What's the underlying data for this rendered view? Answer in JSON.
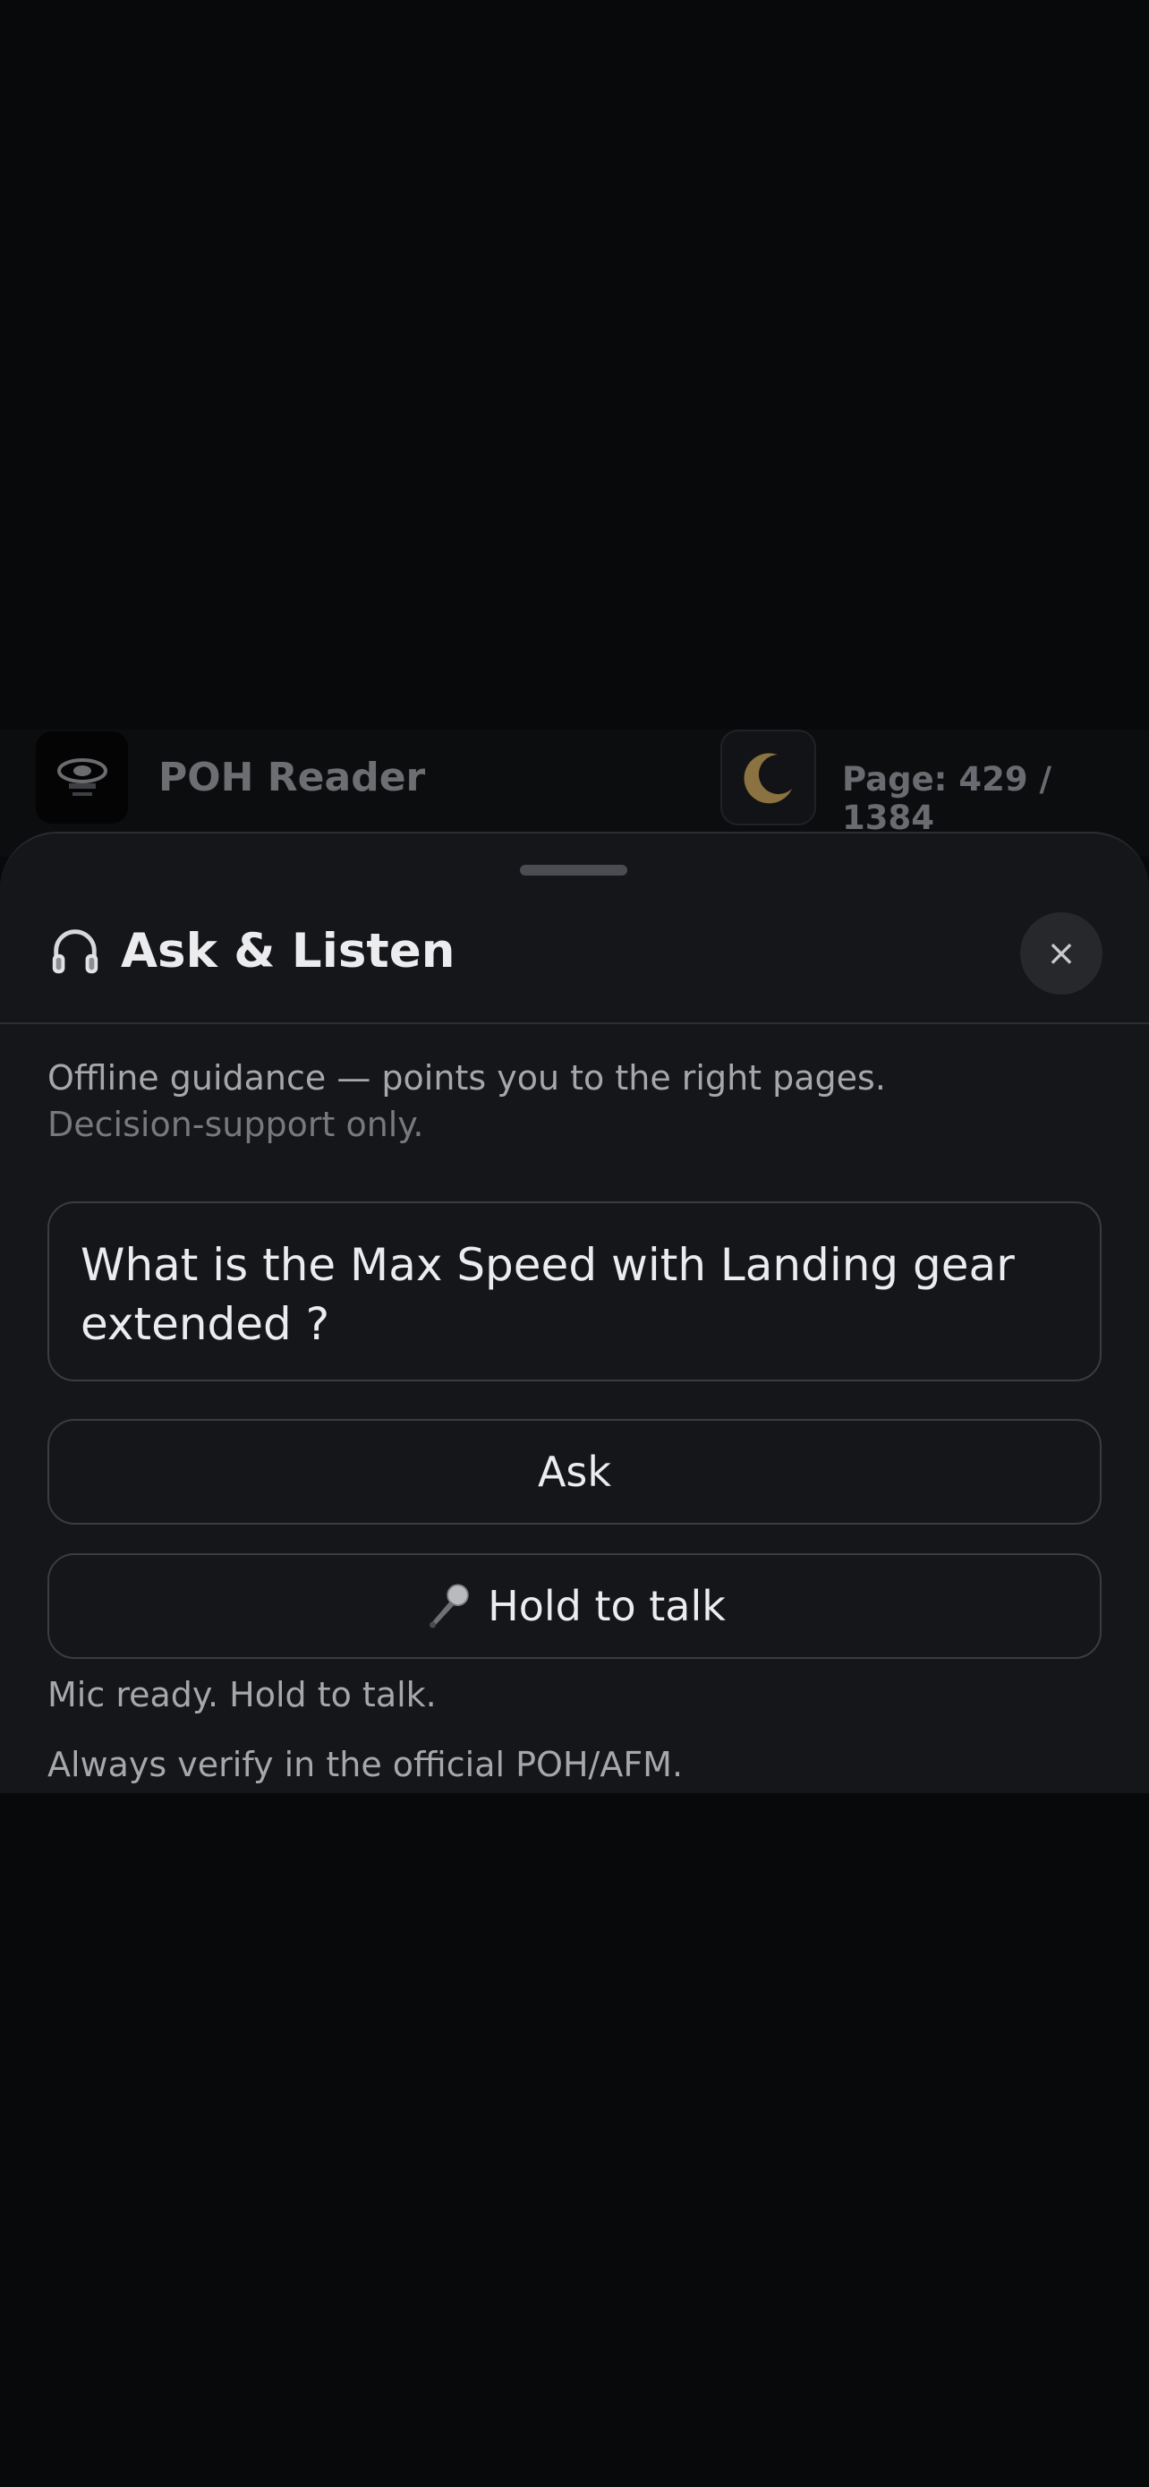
{
  "topbar": {
    "app_title": "POH Reader",
    "page_indicator": "Page: 429 / 1384",
    "logo_icon": "aircraft-logo-icon",
    "theme_icon": "moon-icon"
  },
  "sheet": {
    "title": "Ask & Listen",
    "title_icon": "headphones-icon",
    "close_label": "×",
    "intro_line1": "Offline guidance — points you to the right pages.",
    "intro_line2": "Decision-support only.",
    "question_value": "What is the Max Speed with Landing gear extended ?",
    "ask_label": "Ask",
    "talk_label": "Hold to talk",
    "talk_icon": "microphone-icon",
    "status_text": "Mic ready. Hold to talk.",
    "disclaimer": "Always verify in the official POH/AFM."
  },
  "colors": {
    "background": "#08090b",
    "sheet": "#151619",
    "text": "#ececee",
    "muted_text": "#a6a7ab",
    "moon": "#8a7340"
  }
}
